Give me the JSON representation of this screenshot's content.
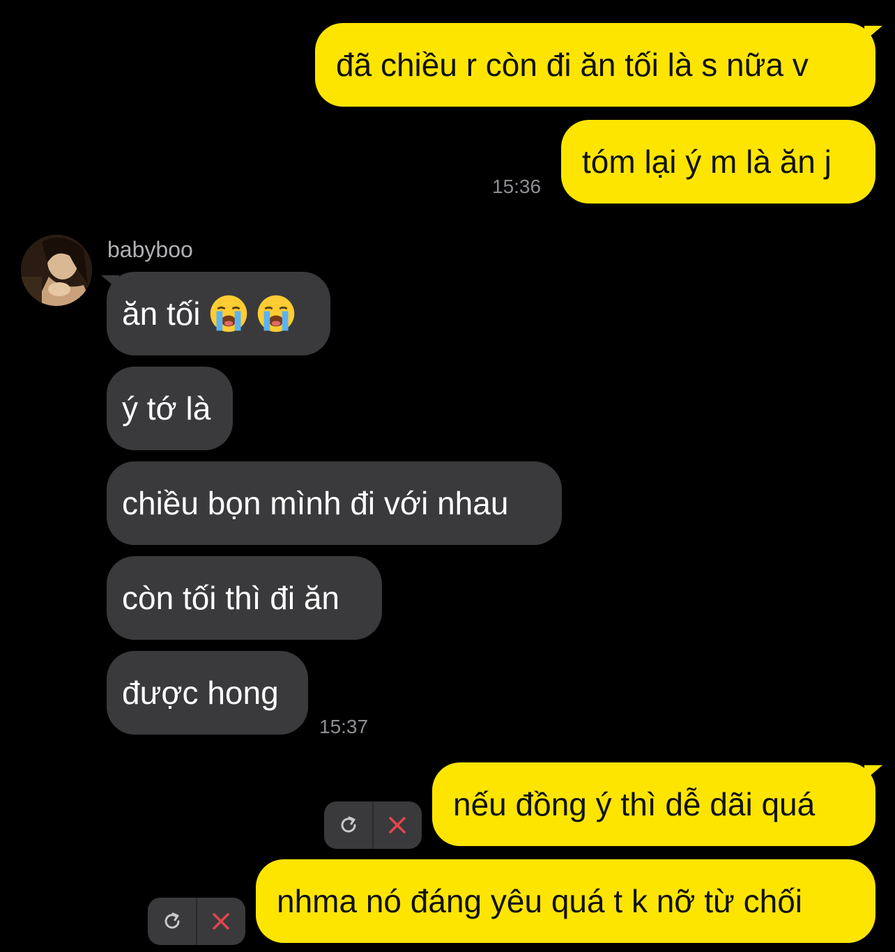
{
  "colors": {
    "background": "#000000",
    "outgoing_bubble": "#fee500",
    "incoming_bubble": "#3a3a3c",
    "timestamp": "#8e8e93",
    "cancel_x": "#e0474c"
  },
  "messages": {
    "out_1": "đã chiều r còn đi ăn tối là s nữa v",
    "out_2": "tóm lại ý m là ăn j",
    "out_time": "15:36",
    "sender_name": "babyboo",
    "in_1": "ăn tối",
    "in_1_emoji": "loudly-crying-face-icon",
    "in_2": "ý tớ là",
    "in_3": "chiều bọn mình đi với nhau",
    "in_4": "còn tối thì đi ăn",
    "in_5": "được hong",
    "in_time": "15:37",
    "out_3": "nếu đồng ý thì dễ dãi quá",
    "out_4": "nhma nó đáng yêu quá t k nỡ từ chối"
  },
  "failed_controls": {
    "retry_icon": "retry-icon",
    "cancel_icon": "close-icon"
  }
}
